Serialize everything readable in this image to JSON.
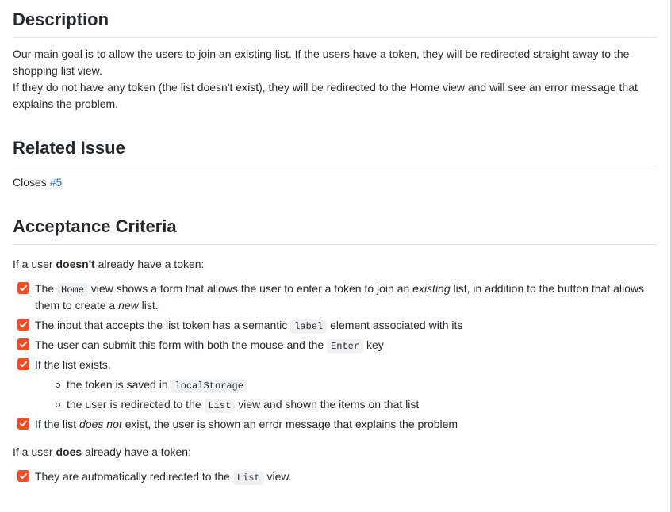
{
  "headings": {
    "description": "Description",
    "related": "Related Issue",
    "acceptance": "Acceptance Criteria"
  },
  "description": {
    "line1a": "Our main goal is to allow the users to join an existing list. If the users have a token, they will be redirected straight away to the shopping list view.",
    "line2a": "If they do not have any token (the list doesn't exist), they will be redirected to the Home view and will see an error message that explains the problem."
  },
  "related": {
    "prefix": "Closes ",
    "issue": "#5"
  },
  "acceptance": {
    "intro_no_token_pre": "If a user ",
    "intro_no_token_bold": "doesn't",
    "intro_no_token_post": " already have a token:",
    "items_no_token": [
      {
        "pre": "The ",
        "code": "Home",
        "mid1": " view shows a form that allows the user to enter a token to join an ",
        "em1": "existing",
        "mid2": " list, in addition to the button that allows them to create a ",
        "em2": "new",
        "post": " list."
      },
      {
        "pre": "The input that accepts the list token has a semantic ",
        "code": "label",
        "post": " element associated with its"
      },
      {
        "pre": "The user can submit this form with both the mouse and the ",
        "code": "Enter",
        "post": " key"
      },
      {
        "pre": "If the list exists,",
        "sub": [
          {
            "pre": "the token is saved in ",
            "code": "localStorage"
          },
          {
            "pre": "the user is redirected to the ",
            "code": "List",
            "post": " view and shown the items on that list"
          }
        ]
      },
      {
        "pre": "If the list ",
        "em1": "does not",
        "post": " exist, the user is shown an error message that explains the problem"
      }
    ],
    "intro_has_token_pre": "If a user ",
    "intro_has_token_bold": "does",
    "intro_has_token_post": " already have a token:",
    "items_has_token": [
      {
        "pre": "They are automatically redirected to the ",
        "code": "List",
        "post": " view."
      }
    ]
  }
}
